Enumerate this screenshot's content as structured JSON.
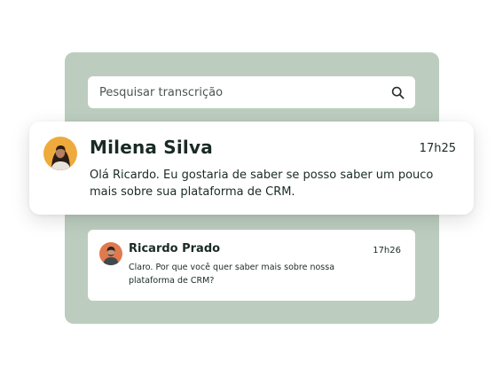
{
  "search": {
    "placeholder": "Pesquisar transcrição"
  },
  "messages": [
    {
      "name": "Milena Silva",
      "time": "17h25",
      "text": "Olá Ricardo. Eu gostaria de saber se posso saber um pouco mais sobre sua plataforma de CRM."
    },
    {
      "name": "Ricardo Prado",
      "time": "17h26",
      "text": "Claro. Por que você quer saber mais sobre nossa plataforma de CRM?"
    }
  ],
  "colors": {
    "panel_background": "#bccdbf",
    "text": "#1a2a25",
    "card_background": "#ffffff"
  }
}
